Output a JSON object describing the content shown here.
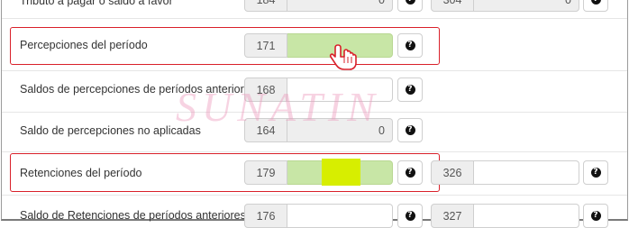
{
  "rows": [
    {
      "label": "Tributo a pagar o saldo a favor",
      "code_a": "184",
      "value_a": "0",
      "code_b": "304",
      "value_b": "0"
    },
    {
      "label": "Percepciones del período",
      "code_a": "171",
      "value_a": ""
    },
    {
      "label": "Saldos de percepciones de períodos anteriores",
      "code_a": "168",
      "value_a": ""
    },
    {
      "label": "Saldo de percepciones no aplicadas",
      "code_a": "164",
      "value_a": "0"
    },
    {
      "label": "Retenciones del período",
      "code_a": "179",
      "value_a": "",
      "code_b": "326",
      "value_b": ""
    },
    {
      "label": "Saldo de Retenciones de períodos anteriores",
      "code_a": "176",
      "value_a": "",
      "code_b": "327",
      "value_b": ""
    }
  ],
  "watermark": "SUNATIN",
  "help_symbol": "?",
  "colors": {
    "highlight_box": "#d9202a",
    "green_field": "#c8e6a6",
    "yellow_marker": "#d7ee00",
    "watermark": "#ec96b9"
  }
}
